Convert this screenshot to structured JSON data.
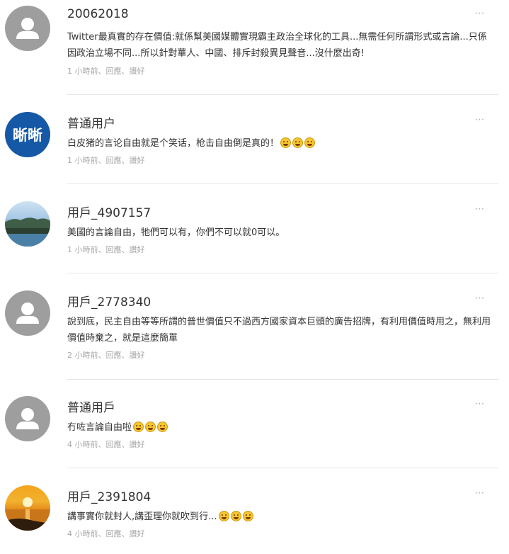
{
  "comments": [
    {
      "username": "20062018",
      "avatar": "default-avatar",
      "text": "Twitter最真實的存在價值:就係幫美國媒體實現霸主政治全球化的工具...無需任何所謂形式或言論...只係因政治立場不同...所以針對華人、中國、排斥封殺異見聲音...沒什麼出奇!",
      "emojis": [],
      "time": "1 小時前",
      "reply": "回應",
      "like": "讚好"
    },
    {
      "username": "普通用户",
      "avatar": "text-avatar",
      "avatar_text": "晰晰",
      "avatar_color": "#1558a6",
      "text": "白皮猪的言论自由就是个笑话，枪击自由倒是真的！",
      "emojis": [
        "rolling-laughing-emoji",
        "rolling-laughing-emoji",
        "rolling-laughing-emoji"
      ],
      "time": "1 小時前",
      "reply": "回應",
      "like": "讚好"
    },
    {
      "username": "用戶_4907157",
      "avatar": "lake-photo-avatar",
      "text": "美國的言論自由，牠們可以有，你們不可以就0可以。",
      "emojis": [],
      "time": "1 小時前",
      "reply": "回應",
      "like": "讚好"
    },
    {
      "username": "用戶_2778340",
      "avatar": "default-avatar",
      "text": "說到底，民主自由等等所謂的普世價值只不過西方國家資本巨頭的廣告招牌，有利用價值時用之，無利用價值時棄之，就是這麼簡單",
      "emojis": [],
      "time": "2 小時前",
      "reply": "回應",
      "like": "讚好"
    },
    {
      "username": "普通用戶",
      "avatar": "default-avatar",
      "text": "冇咗言論自由啦",
      "emojis": [
        "tears-of-joy-emoji",
        "tears-of-joy-emoji",
        "tears-of-joy-emoji"
      ],
      "time": "4 小時前",
      "reply": "回應",
      "like": "讚好"
    },
    {
      "username": "用戶_2391804",
      "avatar": "sunset-photo-avatar",
      "text": "講事實你就封人,講歪理你就吹到行...",
      "emojis": [
        "grinning-squint-emoji",
        "grinning-squint-emoji",
        "grinning-squint-emoji"
      ],
      "time": "4 小時前",
      "reply": "回應",
      "like": "讚好"
    }
  ],
  "more_icon": "⋯",
  "separator": "、"
}
